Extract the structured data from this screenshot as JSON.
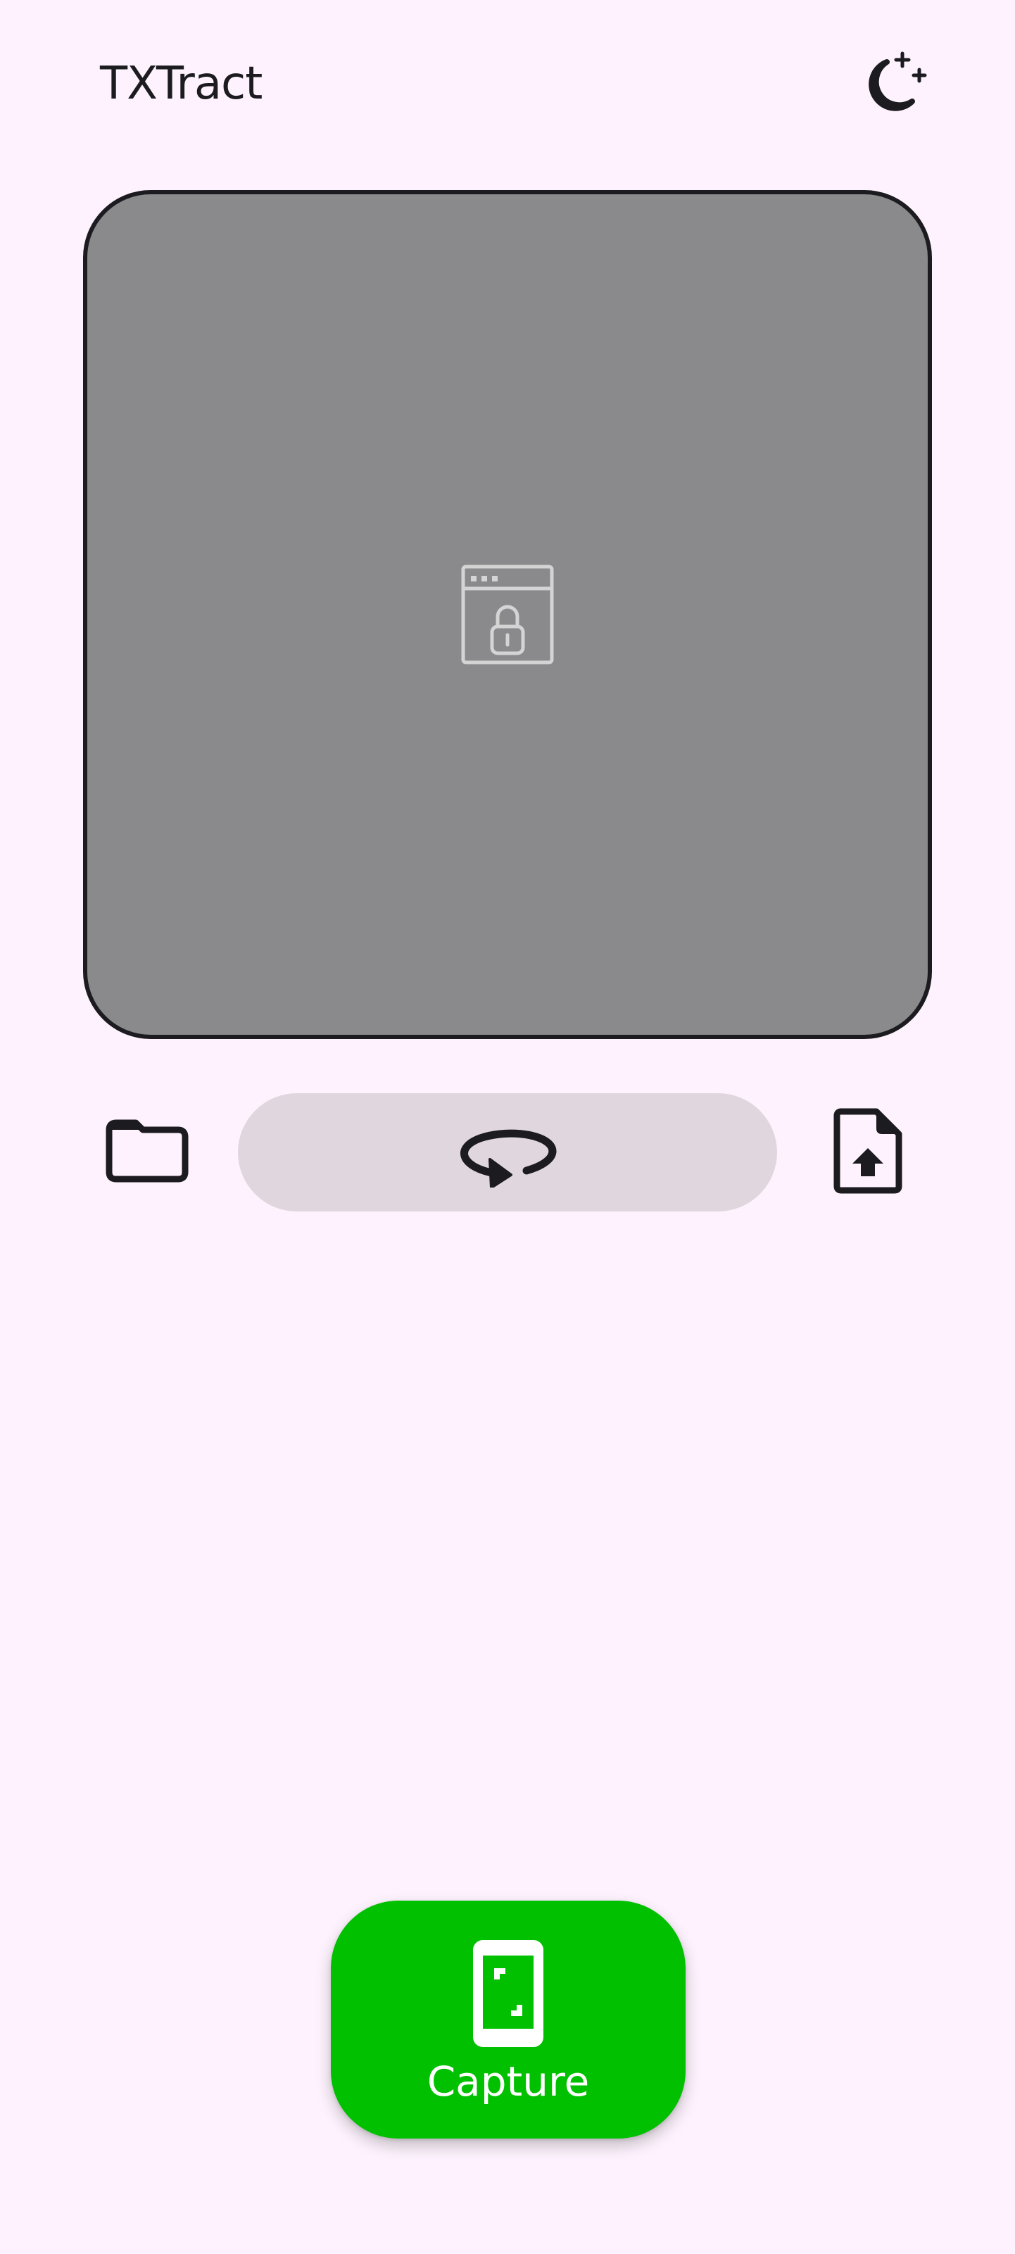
{
  "header": {
    "title": "TXTract",
    "theme_toggle_icon": "moon-stars-icon"
  },
  "preview": {
    "placeholder_icon": "secure-window-lock-icon",
    "background_color": "#8a8a8c"
  },
  "toolbar": {
    "folder_icon": "folder-icon",
    "rotate_icon": "rotate-icon",
    "upload_icon": "file-upload-icon"
  },
  "capture": {
    "label": "Capture",
    "icon": "phone-scan-icon",
    "color": "#00c000"
  },
  "colors": {
    "background": "#fdf2fd",
    "rotate_button": "#e0d6de",
    "text": "#1c1b1f"
  }
}
